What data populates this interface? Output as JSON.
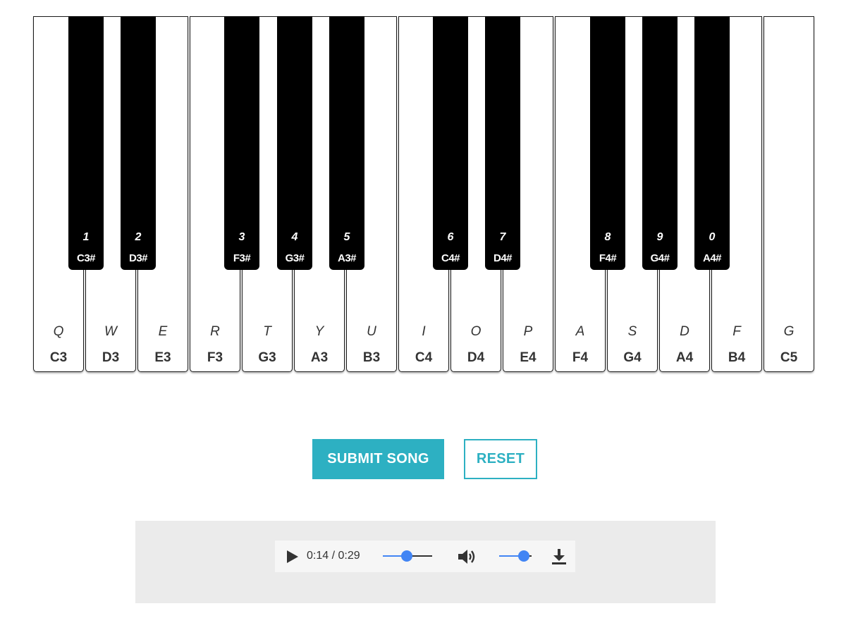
{
  "piano": {
    "white_keys": [
      {
        "key": "Q",
        "note": "C3"
      },
      {
        "key": "W",
        "note": "D3"
      },
      {
        "key": "E",
        "note": "E3"
      },
      {
        "key": "R",
        "note": "F3"
      },
      {
        "key": "T",
        "note": "G3"
      },
      {
        "key": "Y",
        "note": "A3"
      },
      {
        "key": "U",
        "note": "B3"
      },
      {
        "key": "I",
        "note": "C4"
      },
      {
        "key": "O",
        "note": "D4"
      },
      {
        "key": "P",
        "note": "E4"
      },
      {
        "key": "A",
        "note": "F4"
      },
      {
        "key": "S",
        "note": "G4"
      },
      {
        "key": "D",
        "note": "A4"
      },
      {
        "key": "F",
        "note": "B4"
      },
      {
        "key": "G",
        "note": "C5"
      }
    ],
    "black_keys": [
      {
        "key": "1",
        "note": "C3#"
      },
      {
        "key": "2",
        "note": "D3#"
      },
      {
        "key": "3",
        "note": "F3#"
      },
      {
        "key": "4",
        "note": "G3#"
      },
      {
        "key": "5",
        "note": "A3#"
      },
      {
        "key": "6",
        "note": "C4#"
      },
      {
        "key": "7",
        "note": "D4#"
      },
      {
        "key": "8",
        "note": "F4#"
      },
      {
        "key": "9",
        "note": "G4#"
      },
      {
        "key": "0",
        "note": "A4#"
      }
    ]
  },
  "buttons": {
    "submit_label": "SUBMIT SONG",
    "reset_label": "RESET"
  },
  "audio": {
    "time": "0:14 / 0:29",
    "progress_fraction": 0.48,
    "volume_fraction": 0.75,
    "icons": [
      "play-icon",
      "volume-icon",
      "download-icon"
    ]
  },
  "colors": {
    "accent": "#2db0c2",
    "slider": "#4285f4",
    "panel": "#ebebeb"
  }
}
